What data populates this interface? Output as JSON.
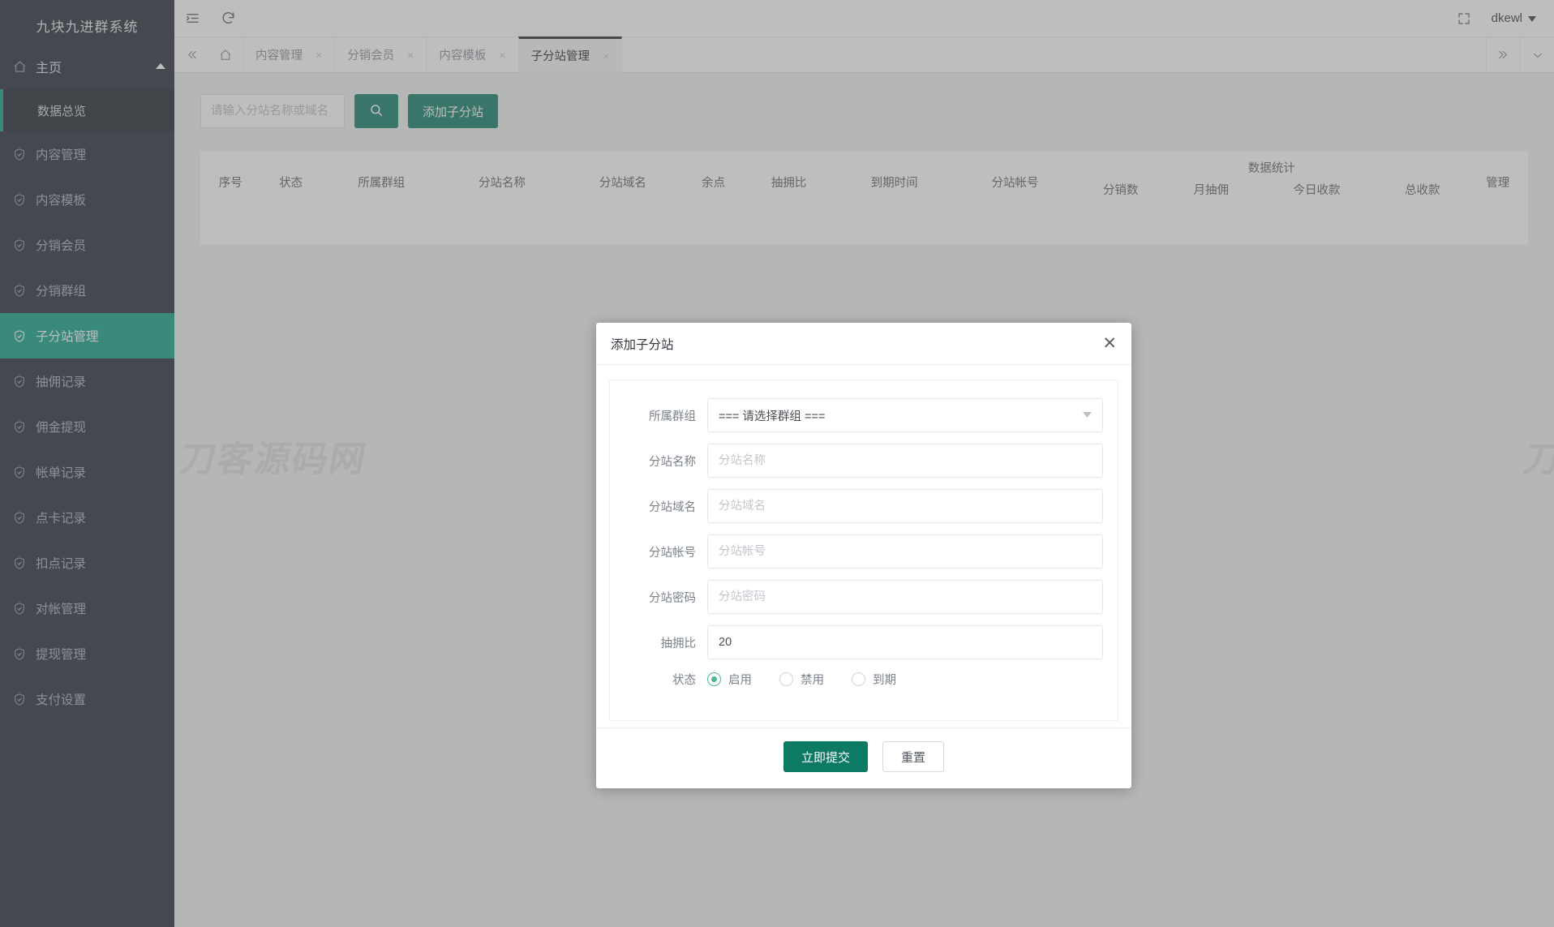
{
  "brand": {
    "title": "九块九进群系统",
    "accent": "#0fa185",
    "button_green": "#0d7a63"
  },
  "sidebar": {
    "home": {
      "label": "主页",
      "icon": "home-icon",
      "caret": "chevron-up-icon"
    },
    "sub_active": {
      "label": "数据总览"
    },
    "items": [
      {
        "label": "内容管理",
        "icon": "shield-check-icon"
      },
      {
        "label": "内容模板",
        "icon": "shield-check-icon"
      },
      {
        "label": "分销会员",
        "icon": "shield-check-icon"
      },
      {
        "label": "分销群组",
        "icon": "shield-check-icon"
      },
      {
        "label": "子分站管理",
        "icon": "shield-check-icon",
        "active": true
      },
      {
        "label": "抽佣记录",
        "icon": "shield-check-icon"
      },
      {
        "label": "佣金提现",
        "icon": "shield-check-icon"
      },
      {
        "label": "帐单记录",
        "icon": "shield-check-icon"
      },
      {
        "label": "点卡记录",
        "icon": "shield-check-icon"
      },
      {
        "label": "扣点记录",
        "icon": "shield-check-icon"
      },
      {
        "label": "对帐管理",
        "icon": "shield-check-icon"
      },
      {
        "label": "提现管理",
        "icon": "shield-check-icon"
      },
      {
        "label": "支付设置",
        "icon": "shield-check-icon"
      }
    ]
  },
  "topbar": {
    "collapse_icon": "sidebar-collapse-icon",
    "refresh_icon": "refresh-icon",
    "fullscreen_icon": "fullscreen-icon",
    "user": "dkewl",
    "user_caret": "caret-down-icon"
  },
  "tabbar": {
    "prev_icon": "double-chevron-left-icon",
    "home_icon": "home-outline-icon",
    "next_icon": "double-chevron-right-icon",
    "more_icon": "chevron-down-icon",
    "close_mark": "×",
    "tabs": [
      {
        "label": "内容管理",
        "active": false
      },
      {
        "label": "分销会员",
        "active": false
      },
      {
        "label": "内容模板",
        "active": false
      },
      {
        "label": "子分站管理",
        "active": true
      }
    ]
  },
  "toolbar": {
    "search_placeholder": "请输入分站名称或域名",
    "search_value": "",
    "search_icon": "search-icon",
    "add_label": "添加子分站"
  },
  "table": {
    "group_header": "数据统计",
    "manage_header": "管理",
    "columns": [
      "序号",
      "状态",
      "所属群组",
      "分站名称",
      "分站域名",
      "余点",
      "抽拥比",
      "到期时间",
      "分站帐号"
    ],
    "stat_columns": [
      "分销数",
      "月抽佣",
      "今日收款",
      "总收款"
    ],
    "rows": []
  },
  "watermark": {
    "text": "刀客源码网"
  },
  "modal": {
    "title": "添加子分站",
    "close_icon": "close-icon",
    "fields": [
      {
        "label": "所属群组",
        "type": "select",
        "value": "=== 请选择群组 ===",
        "caret": "caret-down-icon"
      },
      {
        "label": "分站名称",
        "type": "input",
        "value": "",
        "placeholder": "分站名称"
      },
      {
        "label": "分站域名",
        "type": "input",
        "value": "",
        "placeholder": "分站域名"
      },
      {
        "label": "分站帐号",
        "type": "input",
        "value": "",
        "placeholder": "分站帐号"
      },
      {
        "label": "分站密码",
        "type": "password",
        "value": "",
        "placeholder": "分站密码"
      },
      {
        "label": "抽拥比",
        "type": "input",
        "value": "20",
        "placeholder": ""
      }
    ],
    "status": {
      "label": "状态",
      "options": [
        {
          "label": "启用",
          "checked": true
        },
        {
          "label": "禁用",
          "checked": false
        },
        {
          "label": "到期",
          "checked": false
        }
      ]
    },
    "submit_label": "立即提交",
    "reset_label": "重置"
  }
}
